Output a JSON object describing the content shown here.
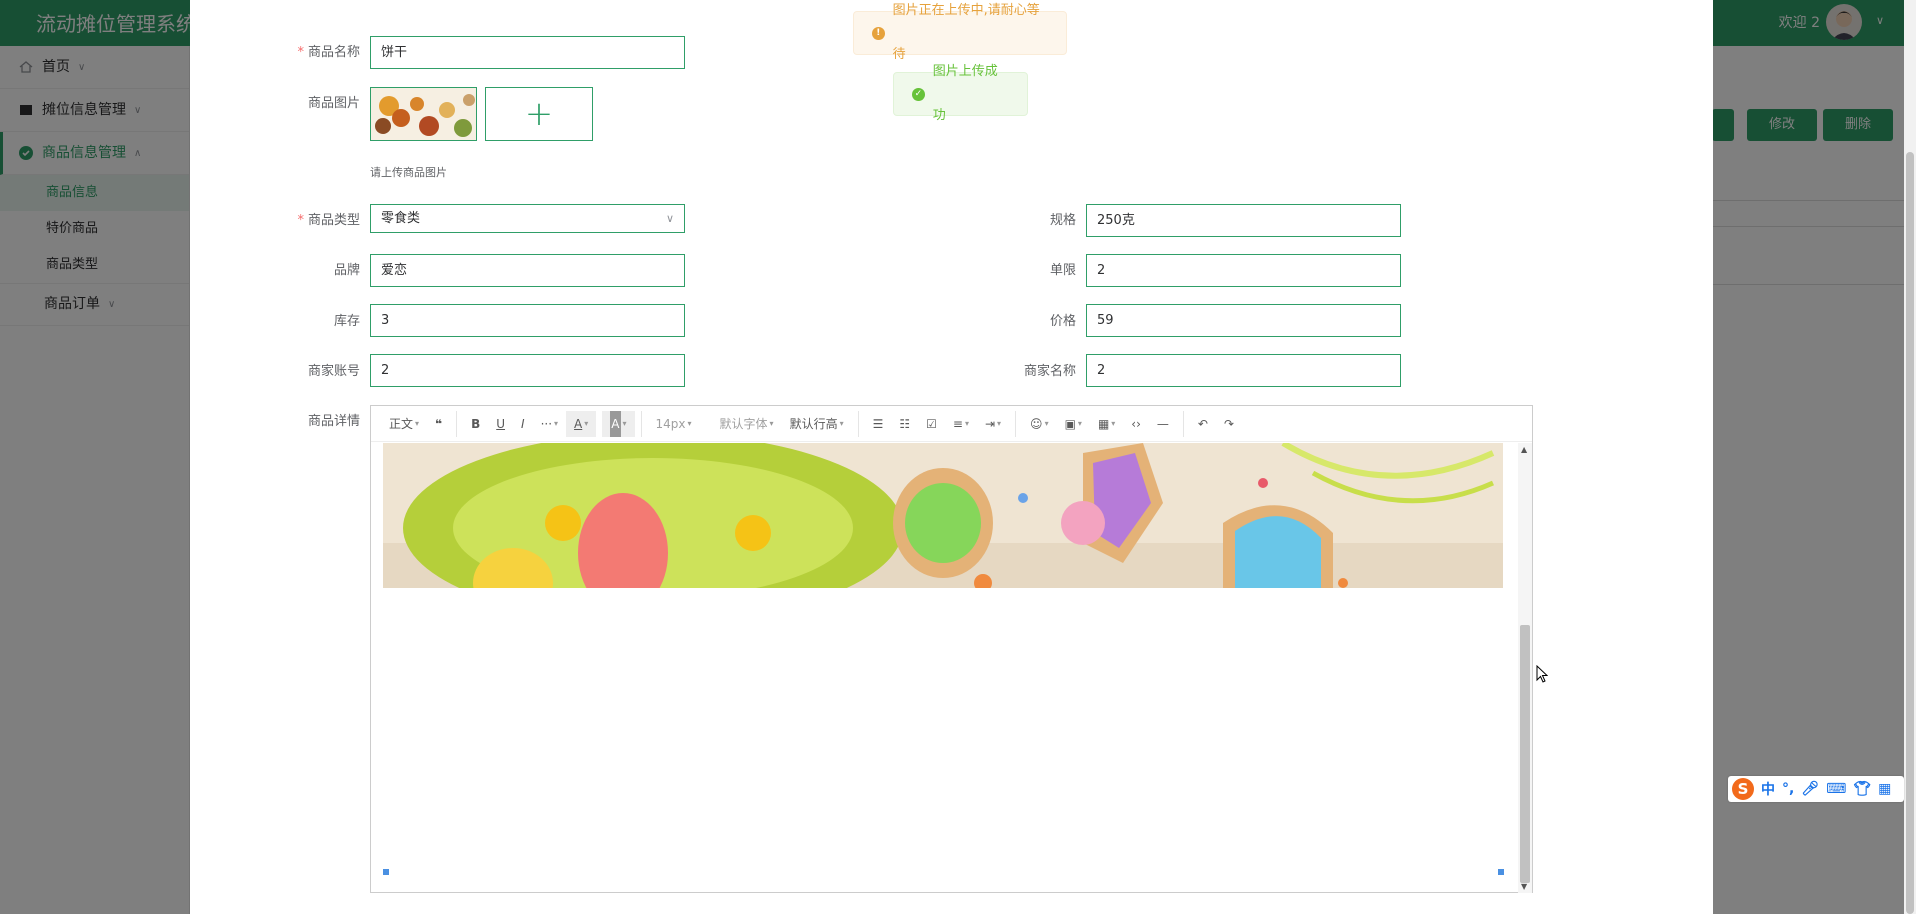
{
  "app": {
    "title": "流动摊位管理系统",
    "welcome": "欢迎 2",
    "avatar_caret": "∨"
  },
  "sidebar": {
    "items": [
      {
        "label": "首页",
        "icon": "home-icon"
      },
      {
        "label": "摊位信息管理",
        "icon": "booth-icon"
      },
      {
        "label": "商品信息管理",
        "icon": "check-circle-icon"
      },
      {
        "label": "商品订单",
        "icon": ""
      }
    ],
    "subitems": [
      "商品信息",
      "特价商品",
      "商品类型"
    ]
  },
  "bg_buttons": {
    "edit": "修改",
    "delete": "删除"
  },
  "messages": {
    "warning": "图片正在上传中,请耐心等待",
    "success": "图片上传成功"
  },
  "form": {
    "name_label": "商品名称",
    "name_value": "饼干",
    "image_label": "商品图片",
    "upload_tip": "请上传商品图片",
    "upload_plus": "+",
    "type_label": "商品类型",
    "type_value": "零食类",
    "spec_label": "规格",
    "spec_value": "250克",
    "brand_label": "品牌",
    "brand_value": "爱恋",
    "limit_label": "单限",
    "limit_value": "2",
    "stock_label": "库存",
    "stock_value": "3",
    "price_label": "价格",
    "price_value": "59",
    "merchant_account_label": "商家账号",
    "merchant_account_value": "2",
    "merchant_name_label": "商家名称",
    "merchant_name_value": "2",
    "detail_label": "商品详情"
  },
  "editor_toolbar": {
    "heading": "正文",
    "quote": "❝",
    "bold": "B",
    "underline": "U",
    "italic": "I",
    "more": "···",
    "font_color": "A",
    "bg_color": "A",
    "font_size": "14px",
    "font_family": "默认字体",
    "line_height": "默认行高",
    "bullets": "☰",
    "numbered": "☷",
    "todo": "☑",
    "align": "≡",
    "indent": "⇥",
    "emoji": "☺",
    "image": "▣",
    "table": "▦",
    "code": "‹›",
    "divider": "—",
    "undo": "↶",
    "redo": "↷"
  },
  "ime": {
    "logo": "S",
    "lang": "中",
    "punct": "°,"
  },
  "colors": {
    "brand": "#2f9e68",
    "warning": "#e6a23c",
    "success": "#67c23a"
  }
}
